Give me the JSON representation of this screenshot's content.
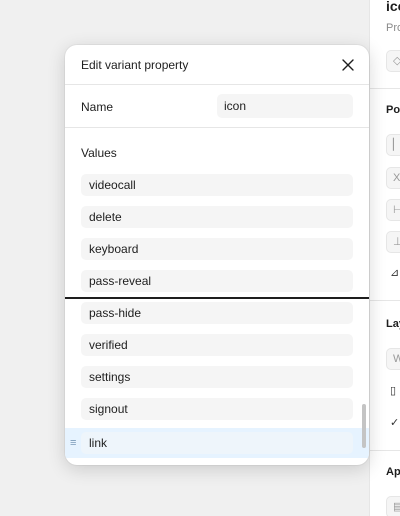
{
  "right_panel": {
    "title": "ico",
    "subtitle": "Pro",
    "section_position": "Po",
    "field_x": "X",
    "field_w": "W",
    "section_layout": "Lay",
    "section_appearance": "Ap"
  },
  "modal": {
    "title": "Edit variant property",
    "name_label": "Name",
    "name_value": "icon",
    "values_label": "Values",
    "values": [
      "videocall",
      "delete",
      "keyboard",
      "pass-reveal",
      "pass-hide",
      "verified",
      "settings",
      "signout"
    ],
    "dragged_value": "link"
  }
}
